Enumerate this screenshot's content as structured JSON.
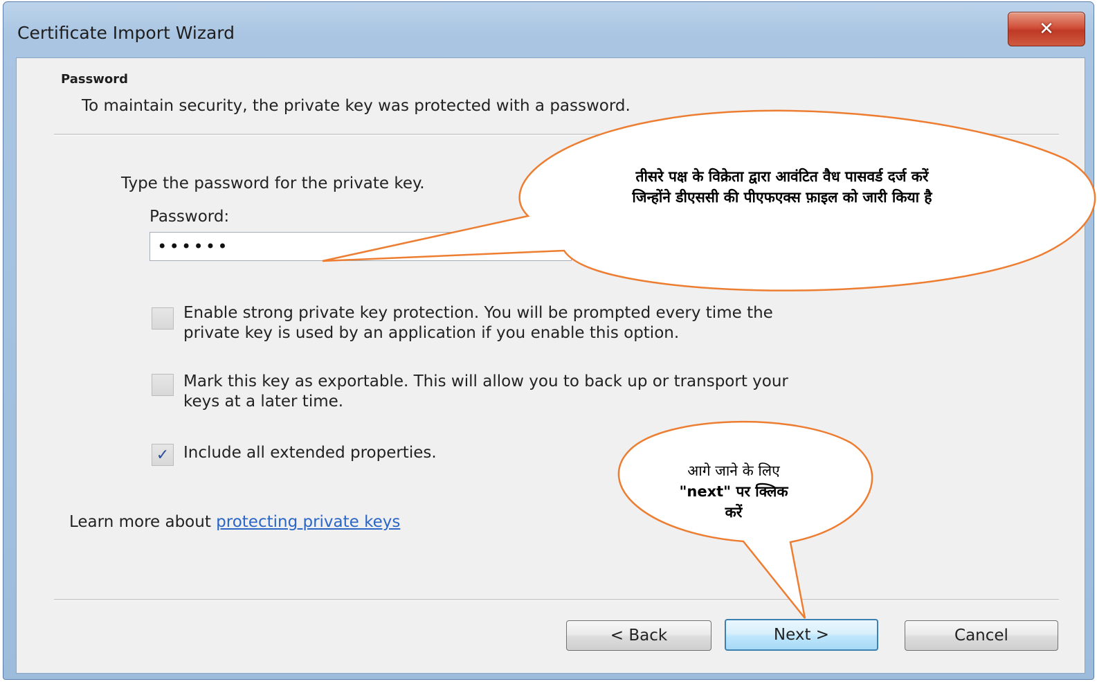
{
  "window": {
    "title": "Certificate Import Wizard",
    "close_symbol": "✕"
  },
  "header": {
    "title": "Password",
    "subtitle": "To maintain security, the private key was protected with a password."
  },
  "form": {
    "prompt": "Type the password for the private key.",
    "password_label": "Password:",
    "password_value": "••••••"
  },
  "options": [
    {
      "line1": "Enable strong private key protection. You will be prompted every time the",
      "line2": "private key is used by an application if you enable this option.",
      "checked": false
    },
    {
      "line1": "Mark this key as exportable. This will allow you to back up or transport your",
      "line2": "keys at a later time.",
      "checked": false
    },
    {
      "line1": "Include all extended properties.",
      "line2": "",
      "checked": true
    }
  ],
  "learn_more": {
    "prefix": "Learn more about ",
    "link": "protecting private keys"
  },
  "buttons": {
    "back": "< Back",
    "next": "Next >",
    "cancel": "Cancel"
  },
  "callouts": {
    "password_note": "तीसरे पक्ष के विक्रेता द्वारा आवंटित वैध पासवर्ड दर्ज करें जिन्होंने डीएससी की पीएफएक्स फ़ाइल को जारी किया है",
    "next_note_line1": "आगे जाने के लिए",
    "next_note_line2": "\"next\" पर क्लिक",
    "next_note_line3": "करें"
  },
  "colors": {
    "callout_fill": "#ffffff",
    "callout_stroke": "#ed7d31",
    "link": "#2a66c6",
    "check": "#2a4f96"
  }
}
